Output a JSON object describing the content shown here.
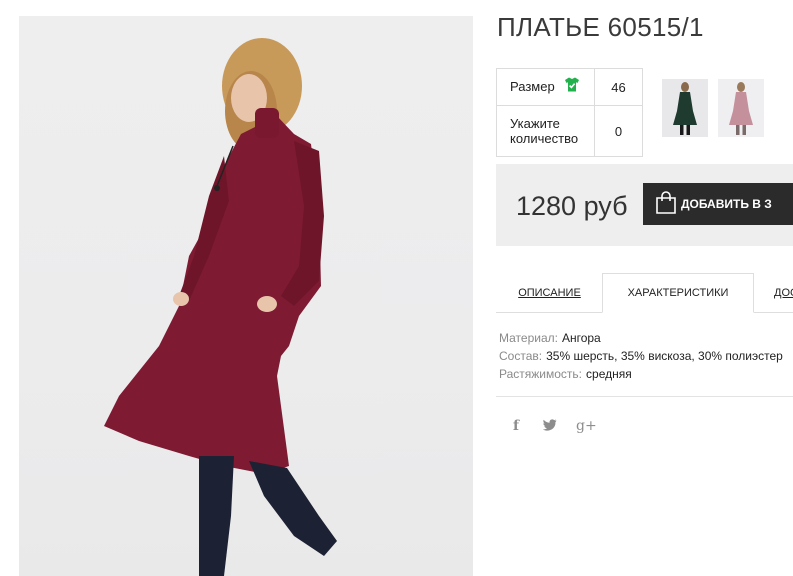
{
  "product": {
    "title": "ПЛАТЬЕ 60515/1",
    "options": {
      "size_label": "Размер",
      "size_value": "46",
      "qty_label_line1": "Укажите",
      "qty_label_line2": "количество",
      "qty_value": "0"
    },
    "price": "1280 руб",
    "add_to_cart_label": "ДОБАВИТЬ В З"
  },
  "tabs": [
    {
      "label": "ОПИСАНИЕ",
      "active": false
    },
    {
      "label": "ХАРАКТЕРИСТИКИ",
      "active": true
    },
    {
      "label": "ДОС",
      "active": false
    }
  ],
  "specs": [
    {
      "key": "Материал:",
      "value": "Ангора"
    },
    {
      "key": "Состав:",
      "value": "35% шерсть, 35% вискоза, 30% полиэстер"
    },
    {
      "key": "Растяжимость:",
      "value": "средняя"
    }
  ],
  "social": {
    "facebook": "f",
    "twitter": "twitter-icon",
    "googleplus": "g+"
  },
  "thumbnails": [
    {
      "color": "dark green"
    },
    {
      "color": "pink"
    }
  ],
  "colors": {
    "dress": "#7e1b33",
    "button": "#2b2b2b",
    "price_bar": "#eeeeee",
    "size_icon": "#22b14c"
  }
}
